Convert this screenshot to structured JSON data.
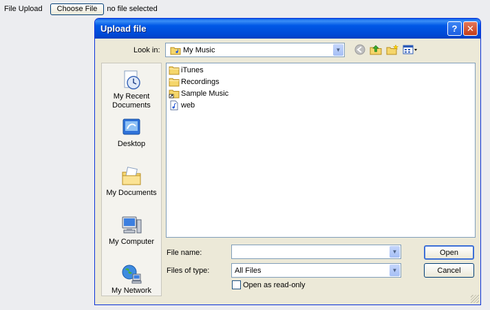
{
  "page": {
    "upload_label": "File Upload",
    "choose_button": "Choose File",
    "no_file_text": "no file selected"
  },
  "dialog": {
    "title": "Upload file",
    "help_glyph": "?",
    "close_glyph": "✕",
    "look_in_label": "Look in:",
    "look_in_value": "My Music",
    "places": [
      {
        "label_line1": "My Recent",
        "label_line2": "Documents",
        "icon": "my-recent-documents-icon"
      },
      {
        "label_line1": "Desktop",
        "label_line2": "",
        "icon": "desktop-icon"
      },
      {
        "label_line1": "My Documents",
        "label_line2": "",
        "icon": "my-documents-icon"
      },
      {
        "label_line1": "My Computer",
        "label_line2": "",
        "icon": "my-computer-icon"
      },
      {
        "label_line1": "My Network",
        "label_line2": "",
        "icon": "my-network-icon"
      }
    ],
    "files": [
      {
        "name": "iTunes",
        "icon": "folder-icon"
      },
      {
        "name": "Recordings",
        "icon": "folder-icon"
      },
      {
        "name": "Sample Music",
        "icon": "shortcut-folder-icon"
      },
      {
        "name": "web",
        "icon": "audio-file-icon"
      }
    ],
    "file_name_label": "File name:",
    "file_name_value": "",
    "files_of_type_label": "Files of type:",
    "files_of_type_value": "All Files",
    "read_only_label": "Open as read-only",
    "open_button": "Open",
    "cancel_button": "Cancel"
  }
}
